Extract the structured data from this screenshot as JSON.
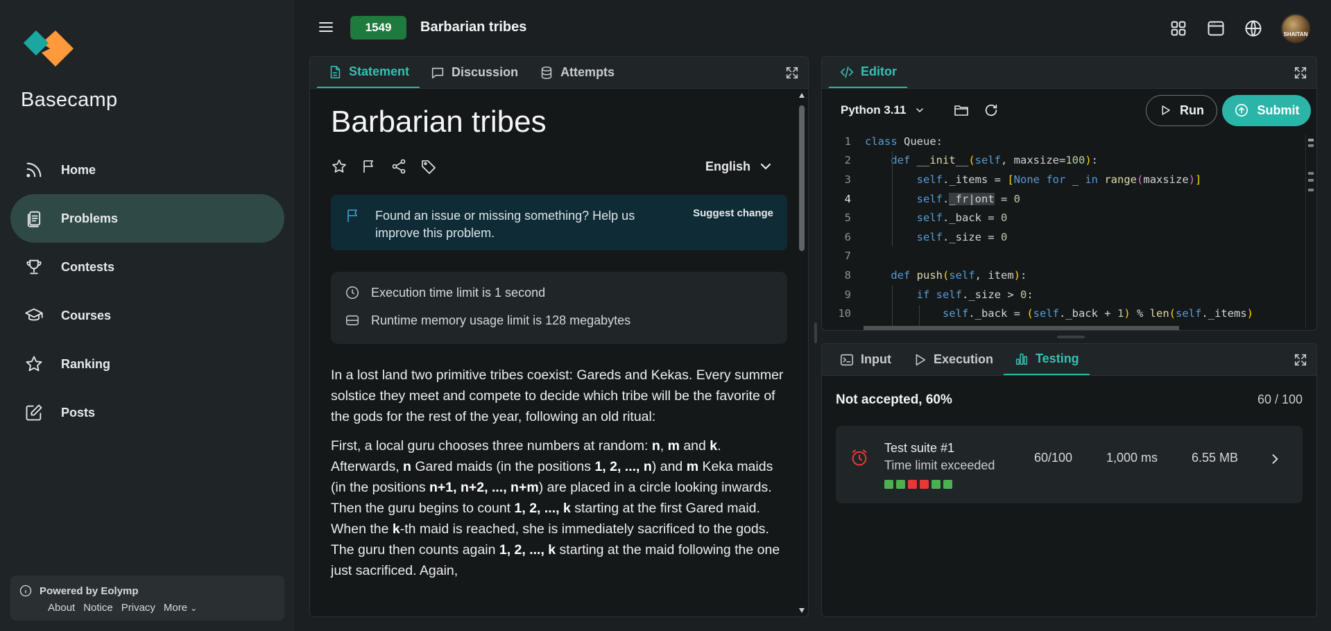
{
  "sidebar": {
    "brand": "Basecamp",
    "items": [
      {
        "label": "Home",
        "icon": "rss-icon"
      },
      {
        "label": "Problems",
        "icon": "clipboard-icon"
      },
      {
        "label": "Contests",
        "icon": "trophy-icon"
      },
      {
        "label": "Courses",
        "icon": "graduation-cap-icon"
      },
      {
        "label": "Ranking",
        "icon": "star-icon"
      },
      {
        "label": "Posts",
        "icon": "edit-icon"
      }
    ],
    "active_index": 1,
    "footer": {
      "powered": "Powered by Eolymp",
      "links": [
        "About",
        "Notice",
        "Privacy",
        "More"
      ]
    }
  },
  "header": {
    "problem_id": "1549",
    "problem_title": "Barbarian tribes",
    "avatar_text": "SHAITAN"
  },
  "statement": {
    "tabs": [
      "Statement",
      "Discussion",
      "Attempts"
    ],
    "title": "Barbarian tribes",
    "language": "English",
    "issue_text": "Found an issue or missing something? Help us improve this problem.",
    "suggest_label": "Suggest change",
    "time_limit": "Execution time limit is 1 second",
    "memory_limit": "Runtime memory usage limit is 128 megabytes",
    "paragraph1": "In a lost land two primitive tribes coexist: Gareds and Kekas. Every summer solstice they meet and compete to decide which tribe will be the favorite of the gods for the rest of the year, following an old ritual:",
    "paragraph2": {
      "t1": "First, a local guru chooses three numbers at random: ",
      "n": "n",
      "m": "m",
      "k": "k",
      "t2": " and ",
      "t3": ". Afterwards, ",
      "t4": " Gared maids (in the positions ",
      "pos1": "1, 2, ..., n",
      "t5": ") and ",
      "t6": " Keka maids (in the positions ",
      "pos2": "n+1, n+2, ..., n+m",
      "t7": ") are placed in a circle looking inwards. Then the guru begins to count ",
      "count": "1, 2, ..., k",
      "t8": " starting at the first Gared maid. When the ",
      "kth": "k",
      "t9": "-th maid is reached, she is immediately sacrificed to the gods. The guru then counts again ",
      "count2": "1, 2, ..., k",
      "t10": " starting at the maid following the one just sacrificed. Again,"
    }
  },
  "editor": {
    "tab": "Editor",
    "language": "Python 3.11",
    "run_label": "Run",
    "submit_label": "Submit",
    "line_numbers": [
      "1",
      "2",
      "3",
      "4",
      "5",
      "6",
      "7",
      "8",
      "9",
      "10"
    ]
  },
  "testing": {
    "tabs": [
      "Input",
      "Execution",
      "Testing"
    ],
    "verdict": "Not accepted, 60%",
    "score": "60 / 100",
    "suite_name": "Test suite #1",
    "suite_status": "Time limit exceeded",
    "suite_score": "60/100",
    "suite_time": "1,000 ms",
    "suite_memory": "6.55 MB",
    "dots": [
      "pass",
      "pass",
      "fail",
      "fail",
      "pass",
      "pass"
    ],
    "colors": {
      "pass": "#4caf50",
      "fail": "#e53935"
    }
  },
  "colors": {
    "accent": "#2bb5a9",
    "badge": "#1f7a3d",
    "active_nav": "#2f4a46"
  }
}
